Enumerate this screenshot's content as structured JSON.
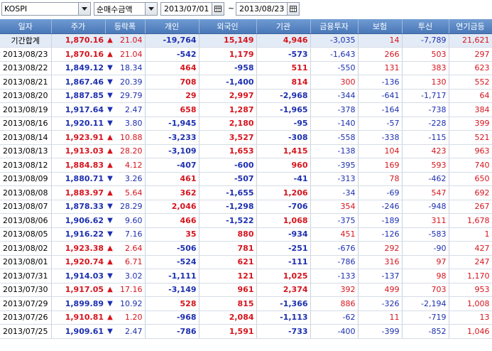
{
  "toolbar": {
    "market": "KOSPI",
    "metric": "순매수금액",
    "start_date": "2013/07/01",
    "separator": "~",
    "end_date": "2013/08/23"
  },
  "columns": [
    "일자",
    "주가",
    "등락폭",
    "개인",
    "외국인",
    "기관",
    "금융투자",
    "보험",
    "투신",
    "연기금등"
  ],
  "rows": [
    {
      "date": "기간합계",
      "price": "1,870.16",
      "dir": "up",
      "chg": "21.04",
      "indiv": "-19,764",
      "foreign": "15,149",
      "inst": "4,946",
      "fin": "-3,035",
      "ins": "14",
      "trust": "-7,789",
      "pension": "21,621",
      "total": true
    },
    {
      "date": "2013/08/23",
      "price": "1,870.16",
      "dir": "up",
      "chg": "21.04",
      "indiv": "-542",
      "foreign": "1,179",
      "inst": "-573",
      "fin": "-1,643",
      "ins": "266",
      "trust": "503",
      "pension": "297"
    },
    {
      "date": "2013/08/22",
      "price": "1,849.12",
      "dir": "down",
      "chg": "18.34",
      "indiv": "464",
      "foreign": "-958",
      "inst": "511",
      "fin": "-550",
      "ins": "131",
      "trust": "383",
      "pension": "623"
    },
    {
      "date": "2013/08/21",
      "price": "1,867.46",
      "dir": "down",
      "chg": "20.39",
      "indiv": "708",
      "foreign": "-1,400",
      "inst": "814",
      "fin": "300",
      "ins": "-136",
      "trust": "130",
      "pension": "552"
    },
    {
      "date": "2013/08/20",
      "price": "1,887.85",
      "dir": "down",
      "chg": "29.79",
      "indiv": "29",
      "foreign": "2,997",
      "inst": "-2,968",
      "fin": "-344",
      "ins": "-641",
      "trust": "-1,717",
      "pension": "64"
    },
    {
      "date": "2013/08/19",
      "price": "1,917.64",
      "dir": "down",
      "chg": "2.47",
      "indiv": "658",
      "foreign": "1,287",
      "inst": "-1,965",
      "fin": "-378",
      "ins": "-164",
      "trust": "-738",
      "pension": "384"
    },
    {
      "date": "2013/08/16",
      "price": "1,920.11",
      "dir": "down",
      "chg": "3.80",
      "indiv": "-1,945",
      "foreign": "2,180",
      "inst": "-95",
      "fin": "-140",
      "ins": "-57",
      "trust": "-228",
      "pension": "399"
    },
    {
      "date": "2013/08/14",
      "price": "1,923.91",
      "dir": "up",
      "chg": "10.88",
      "indiv": "-3,233",
      "foreign": "3,527",
      "inst": "-308",
      "fin": "-558",
      "ins": "-338",
      "trust": "-115",
      "pension": "521"
    },
    {
      "date": "2013/08/13",
      "price": "1,913.03",
      "dir": "up",
      "chg": "28.20",
      "indiv": "-3,109",
      "foreign": "1,653",
      "inst": "1,415",
      "fin": "-138",
      "ins": "104",
      "trust": "423",
      "pension": "963"
    },
    {
      "date": "2013/08/12",
      "price": "1,884.83",
      "dir": "up",
      "chg": "4.12",
      "indiv": "-407",
      "foreign": "-600",
      "inst": "960",
      "fin": "-395",
      "ins": "169",
      "trust": "593",
      "pension": "740"
    },
    {
      "date": "2013/08/09",
      "price": "1,880.71",
      "dir": "down",
      "chg": "3.26",
      "indiv": "461",
      "foreign": "-507",
      "inst": "-41",
      "fin": "-313",
      "ins": "78",
      "trust": "-462",
      "pension": "650"
    },
    {
      "date": "2013/08/08",
      "price": "1,883.97",
      "dir": "up",
      "chg": "5.64",
      "indiv": "362",
      "foreign": "-1,655",
      "inst": "1,206",
      "fin": "-34",
      "ins": "-69",
      "trust": "547",
      "pension": "692"
    },
    {
      "date": "2013/08/07",
      "price": "1,878.33",
      "dir": "down",
      "chg": "28.29",
      "indiv": "2,046",
      "foreign": "-1,298",
      "inst": "-706",
      "fin": "354",
      "ins": "-246",
      "trust": "-948",
      "pension": "267"
    },
    {
      "date": "2013/08/06",
      "price": "1,906.62",
      "dir": "down",
      "chg": "9.60",
      "indiv": "466",
      "foreign": "-1,522",
      "inst": "1,068",
      "fin": "-375",
      "ins": "-189",
      "trust": "311",
      "pension": "1,678"
    },
    {
      "date": "2013/08/05",
      "price": "1,916.22",
      "dir": "down",
      "chg": "7.16",
      "indiv": "35",
      "foreign": "880",
      "inst": "-934",
      "fin": "451",
      "ins": "-126",
      "trust": "-583",
      "pension": "1"
    },
    {
      "date": "2013/08/02",
      "price": "1,923.38",
      "dir": "up",
      "chg": "2.64",
      "indiv": "-506",
      "foreign": "781",
      "inst": "-251",
      "fin": "-676",
      "ins": "292",
      "trust": "-90",
      "pension": "427"
    },
    {
      "date": "2013/08/01",
      "price": "1,920.74",
      "dir": "up",
      "chg": "6.71",
      "indiv": "-524",
      "foreign": "621",
      "inst": "-111",
      "fin": "-786",
      "ins": "316",
      "trust": "97",
      "pension": "247"
    },
    {
      "date": "2013/07/31",
      "price": "1,914.03",
      "dir": "down",
      "chg": "3.02",
      "indiv": "-1,111",
      "foreign": "121",
      "inst": "1,025",
      "fin": "-133",
      "ins": "-137",
      "trust": "98",
      "pension": "1,170"
    },
    {
      "date": "2013/07/30",
      "price": "1,917.05",
      "dir": "up",
      "chg": "17.16",
      "indiv": "-3,149",
      "foreign": "961",
      "inst": "2,374",
      "fin": "392",
      "ins": "499",
      "trust": "703",
      "pension": "953"
    },
    {
      "date": "2013/07/29",
      "price": "1,899.89",
      "dir": "down",
      "chg": "10.92",
      "indiv": "528",
      "foreign": "815",
      "inst": "-1,366",
      "fin": "886",
      "ins": "-326",
      "trust": "-2,194",
      "pension": "1,008"
    },
    {
      "date": "2013/07/26",
      "price": "1,910.81",
      "dir": "up",
      "chg": "1.20",
      "indiv": "-968",
      "foreign": "2,084",
      "inst": "-1,113",
      "fin": "-62",
      "ins": "11",
      "trust": "-719",
      "pension": "13"
    },
    {
      "date": "2013/07/25",
      "price": "1,909.61",
      "dir": "down",
      "chg": "2.47",
      "indiv": "-786",
      "foreign": "1,591",
      "inst": "-733",
      "fin": "-400",
      "ins": "-399",
      "trust": "-852",
      "pension": "1,046"
    }
  ],
  "colors": {
    "up": "#d6141d",
    "down": "#1c2fb0",
    "header": "#5a86c4",
    "total_row": "#e3ebf6"
  }
}
